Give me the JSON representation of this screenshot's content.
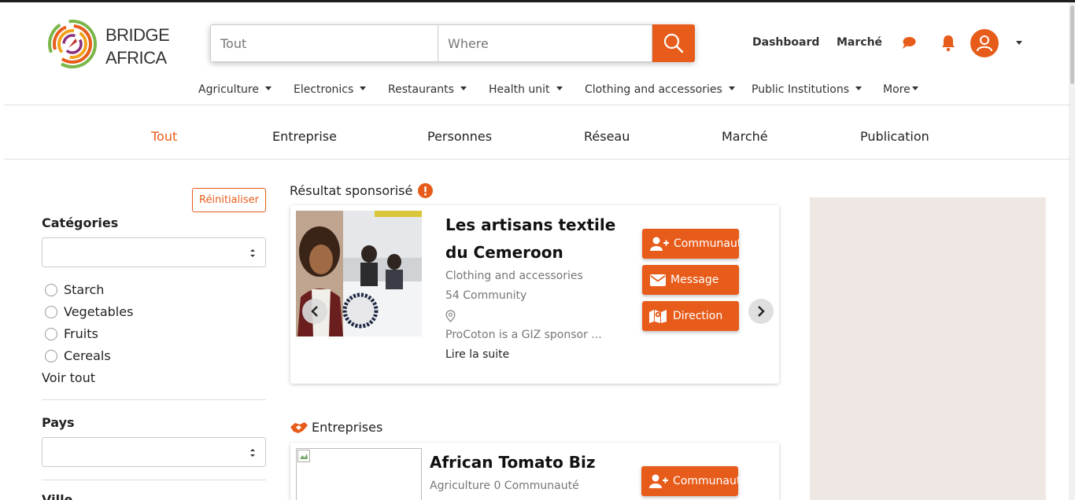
{
  "brand": {
    "line1": "BRIDGE",
    "line2": "AFRICA"
  },
  "search": {
    "what_placeholder": "Tout",
    "where_placeholder": "Where"
  },
  "nav": {
    "dashboard": "Dashboard",
    "market": "Marché"
  },
  "categories": [
    "Agriculture",
    "Electronics",
    "Restaurants",
    "Health unit",
    "Clothing and accessories",
    "Public Institutions",
    "More"
  ],
  "tabs": [
    {
      "label": "Tout",
      "active": true
    },
    {
      "label": "Entreprise",
      "active": false
    },
    {
      "label": "Personnes",
      "active": false
    },
    {
      "label": "Réseau",
      "active": false
    },
    {
      "label": "Marché",
      "active": false
    },
    {
      "label": "Publication",
      "active": false
    }
  ],
  "sidebar": {
    "reset": "Réinitialiser",
    "categories_title": "Catégories",
    "category_options": [
      "Starch",
      "Vegetables",
      "Fruits",
      "Cereals"
    ],
    "see_all": "Voir tout",
    "country_title": "Pays",
    "city_title": "Ville"
  },
  "sponsored": {
    "title": "Résultat sponsorisé",
    "name_line1": "Les artisans textile",
    "name_line2": "du Cemeroon",
    "category": "Clothing and accessories",
    "community": "54 Community",
    "description": "ProCoton is a GIZ sponsor ...",
    "read_more": "Lire la suite",
    "btn_community": "Communauté",
    "btn_message": "Message",
    "btn_direction": "Direction"
  },
  "businesses": {
    "title": "Entreprises",
    "first": {
      "name": "African Tomato Biz",
      "meta": "Agriculture 0 Communauté",
      "btn_community": "Communauté"
    }
  },
  "colors": {
    "accent": "#e75c1a",
    "ad_background": "#efe7e3"
  }
}
